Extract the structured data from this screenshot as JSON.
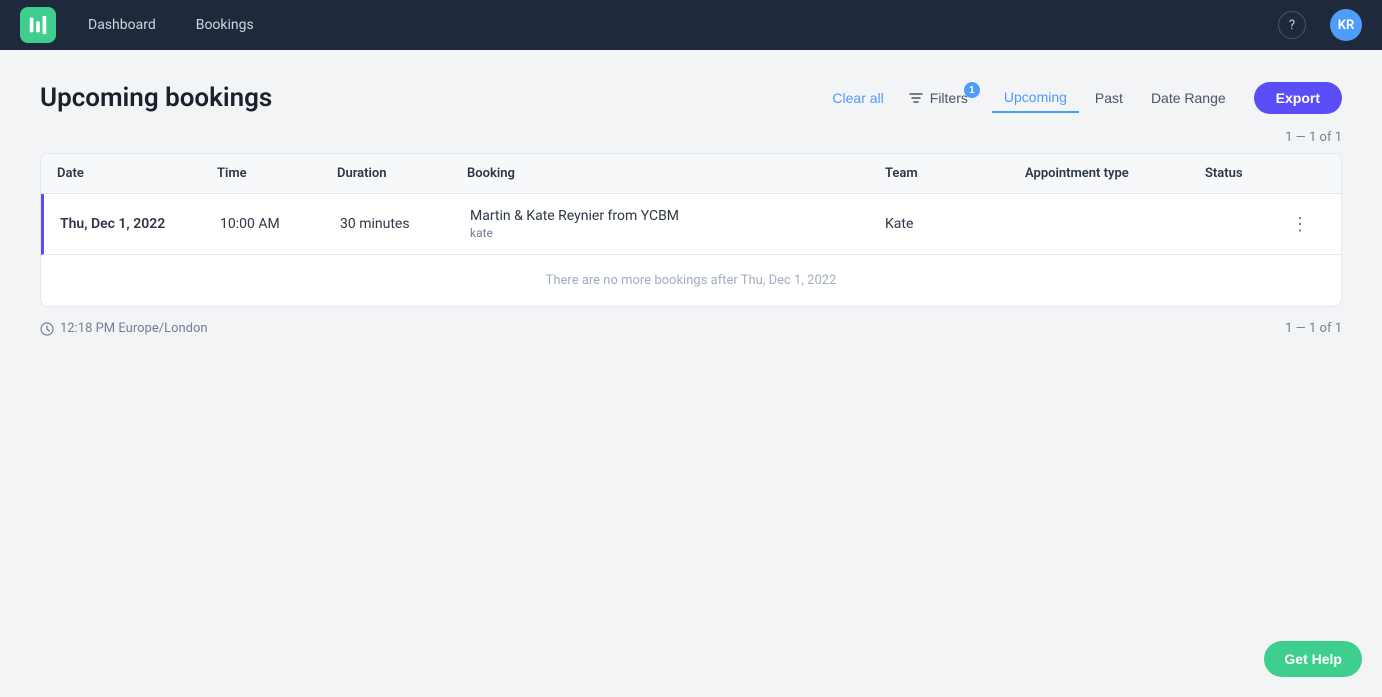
{
  "navbar": {
    "logo_alt": "YCBM Logo",
    "links": [
      "Dashboard",
      "Bookings"
    ],
    "help_icon": "?",
    "avatar_initials": "KR"
  },
  "page": {
    "title": "Upcoming bookings",
    "clear_all_label": "Clear all",
    "filters_label": "Filters",
    "filters_badge": "1",
    "tabs": [
      {
        "id": "upcoming",
        "label": "Upcoming",
        "active": true
      },
      {
        "id": "past",
        "label": "Past",
        "active": false
      },
      {
        "id": "date-range",
        "label": "Date Range",
        "active": false
      }
    ],
    "export_label": "Export"
  },
  "pagination_top": "1 — 1 of 1",
  "table": {
    "columns": [
      "Date",
      "Time",
      "Duration",
      "Booking",
      "Team",
      "Appointment type",
      "Status",
      ""
    ],
    "rows": [
      {
        "date": "Thu, Dec 1, 2022",
        "time": "10:00 AM",
        "duration": "30 minutes",
        "booking_name": "Martin & Kate Reynier from YCBM",
        "booking_sub": "kate",
        "team": "Kate",
        "appointment_type": "",
        "status": ""
      }
    ],
    "no_more_message": "There are no more bookings after Thu, Dec 1, 2022"
  },
  "footer": {
    "timezone": "12:18 PM Europe/London",
    "pagination": "1 — 1 of 1"
  },
  "get_help_label": "Get Help"
}
